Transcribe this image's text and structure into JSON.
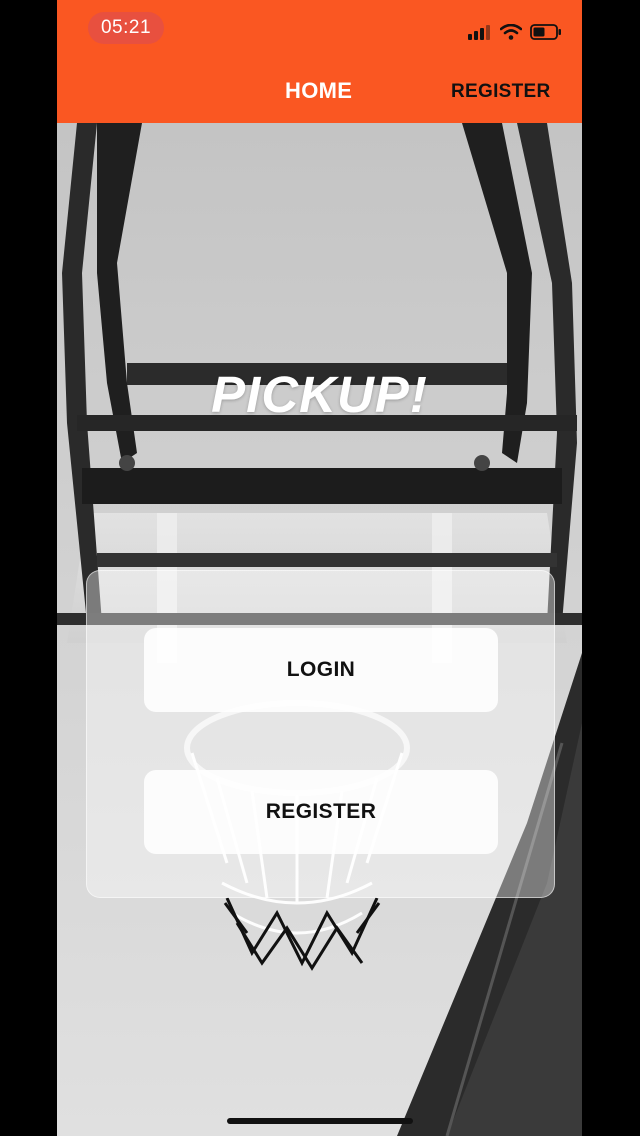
{
  "status_bar": {
    "time": "05:21",
    "icons": [
      "signal-icon",
      "wifi-icon",
      "battery-icon"
    ]
  },
  "nav": {
    "home_label": "HOME",
    "register_label": "REGISTER"
  },
  "hero": {
    "title": "PICKUP!"
  },
  "card": {
    "login_label": "LOGIN",
    "register_label": "REGISTER"
  },
  "colors": {
    "header": "#fa5722",
    "time_pill": "#e8503f"
  }
}
